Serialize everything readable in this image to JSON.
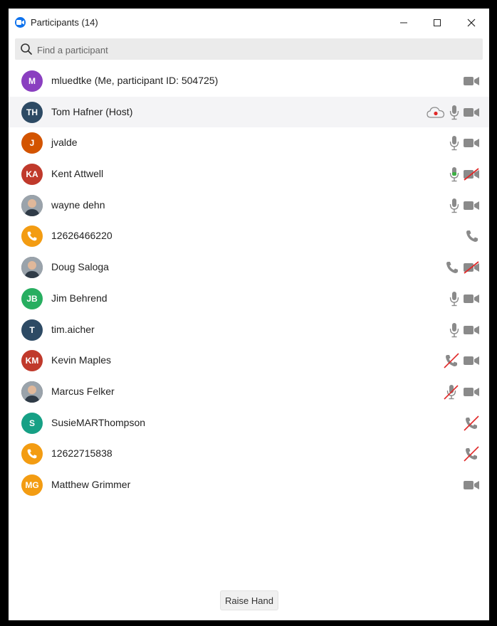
{
  "window": {
    "title": "Participants (14)"
  },
  "search": {
    "placeholder": "Find a participant"
  },
  "participants": [
    {
      "name": "mluedtke (Me, participant ID: 504725)",
      "initials": "M",
      "color": "#8a3fc0",
      "avatar": "initials",
      "icons": [
        "video-icon"
      ]
    },
    {
      "name": "Tom Hafner (Host)",
      "initials": "TH",
      "color": "#2d4a64",
      "avatar": "initials",
      "icons": [
        "cloud-record-icon",
        "mic-icon",
        "video-icon"
      ]
    },
    {
      "name": "jvalde",
      "initials": "J",
      "color": "#d35400",
      "avatar": "initials",
      "icons": [
        "mic-icon",
        "video-icon"
      ]
    },
    {
      "name": "Kent Attwell",
      "initials": "KA",
      "color": "#c0392b",
      "avatar": "initials",
      "icons": [
        "mic-active-icon",
        "video-off-icon"
      ]
    },
    {
      "name": "wayne dehn",
      "initials": "",
      "color": "#6b6b6b",
      "avatar": "photo",
      "icons": [
        "mic-icon",
        "video-icon"
      ]
    },
    {
      "name": "12626466220",
      "initials": "",
      "color": "#f39c12",
      "avatar": "phone",
      "icons": [
        "phone-icon"
      ]
    },
    {
      "name": "Doug Saloga",
      "initials": "",
      "color": "#4a5560",
      "avatar": "photo",
      "icons": [
        "phone-icon",
        "video-off-icon"
      ]
    },
    {
      "name": "Jim Behrend",
      "initials": "JB",
      "color": "#27ae60",
      "avatar": "initials",
      "icons": [
        "mic-icon",
        "video-icon"
      ]
    },
    {
      "name": "tim.aicher",
      "initials": "T",
      "color": "#2d4a64",
      "avatar": "initials",
      "icons": [
        "mic-icon",
        "video-icon"
      ]
    },
    {
      "name": "Kevin Maples",
      "initials": "KM",
      "color": "#c0392b",
      "avatar": "initials",
      "icons": [
        "phone-muted-icon",
        "video-icon"
      ]
    },
    {
      "name": "Marcus Felker",
      "initials": "",
      "color": "#3a3a3a",
      "avatar": "photo",
      "icons": [
        "mic-muted-icon",
        "video-icon"
      ]
    },
    {
      "name": "SusieMARThompson",
      "initials": "S",
      "color": "#16a085",
      "avatar": "initials",
      "icons": [
        "phone-muted-icon"
      ]
    },
    {
      "name": "12622715838",
      "initials": "",
      "color": "#f39c12",
      "avatar": "phone",
      "icons": [
        "phone-muted-icon"
      ]
    },
    {
      "name": "Matthew Grimmer",
      "initials": "MG",
      "color": "#f39c12",
      "avatar": "initials",
      "icons": [
        "video-icon"
      ]
    }
  ],
  "footer": {
    "raise_hand_label": "Raise Hand"
  },
  "colors": {
    "accent": "#0e72ed",
    "icon_gray": "#8a8a8a",
    "muted_red": "#e02828",
    "mic_active_green": "#3cb043",
    "row_highlight": "#f4f4f6"
  }
}
